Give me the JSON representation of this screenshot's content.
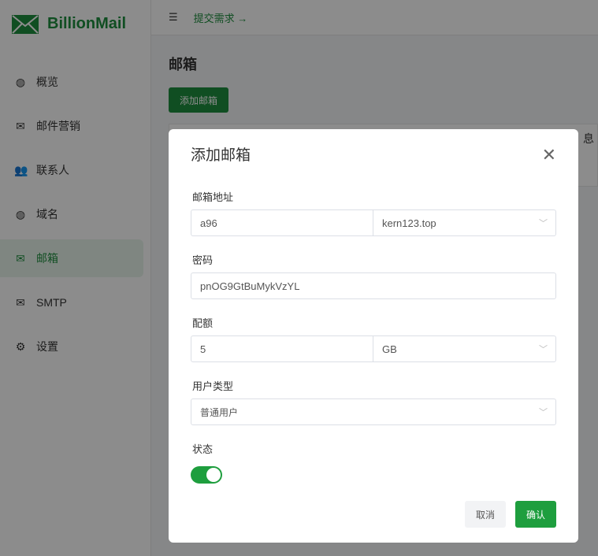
{
  "app": {
    "name": "BillionMail"
  },
  "sidebar": {
    "items": [
      {
        "label": "概览",
        "icon": "globe-icon"
      },
      {
        "label": "邮件营销",
        "icon": "mail-list-icon"
      },
      {
        "label": "联系人",
        "icon": "users-icon"
      },
      {
        "label": "域名",
        "icon": "globe-icon"
      },
      {
        "label": "邮箱",
        "icon": "mailbox-icon"
      },
      {
        "label": "SMTP",
        "icon": "mail-send-icon"
      },
      {
        "label": "设置",
        "icon": "gear-icon"
      }
    ]
  },
  "topbar": {
    "link": "提交需求 →"
  },
  "page": {
    "title": "邮箱",
    "add_button": "添加邮箱",
    "background_text": "息"
  },
  "modal": {
    "title": "添加邮箱",
    "email_label": "邮箱地址",
    "email_user": "a96",
    "email_domain": "kern123.top",
    "password_label": "密码",
    "password": "pnOG9GtBuMykVzYL",
    "quota_label": "配额",
    "quota": "5",
    "quota_unit": "GB",
    "user_type_label": "用户类型",
    "user_type": "普通用户",
    "status_label": "状态",
    "status_on": true,
    "cancel": "取消",
    "confirm": "确认"
  }
}
